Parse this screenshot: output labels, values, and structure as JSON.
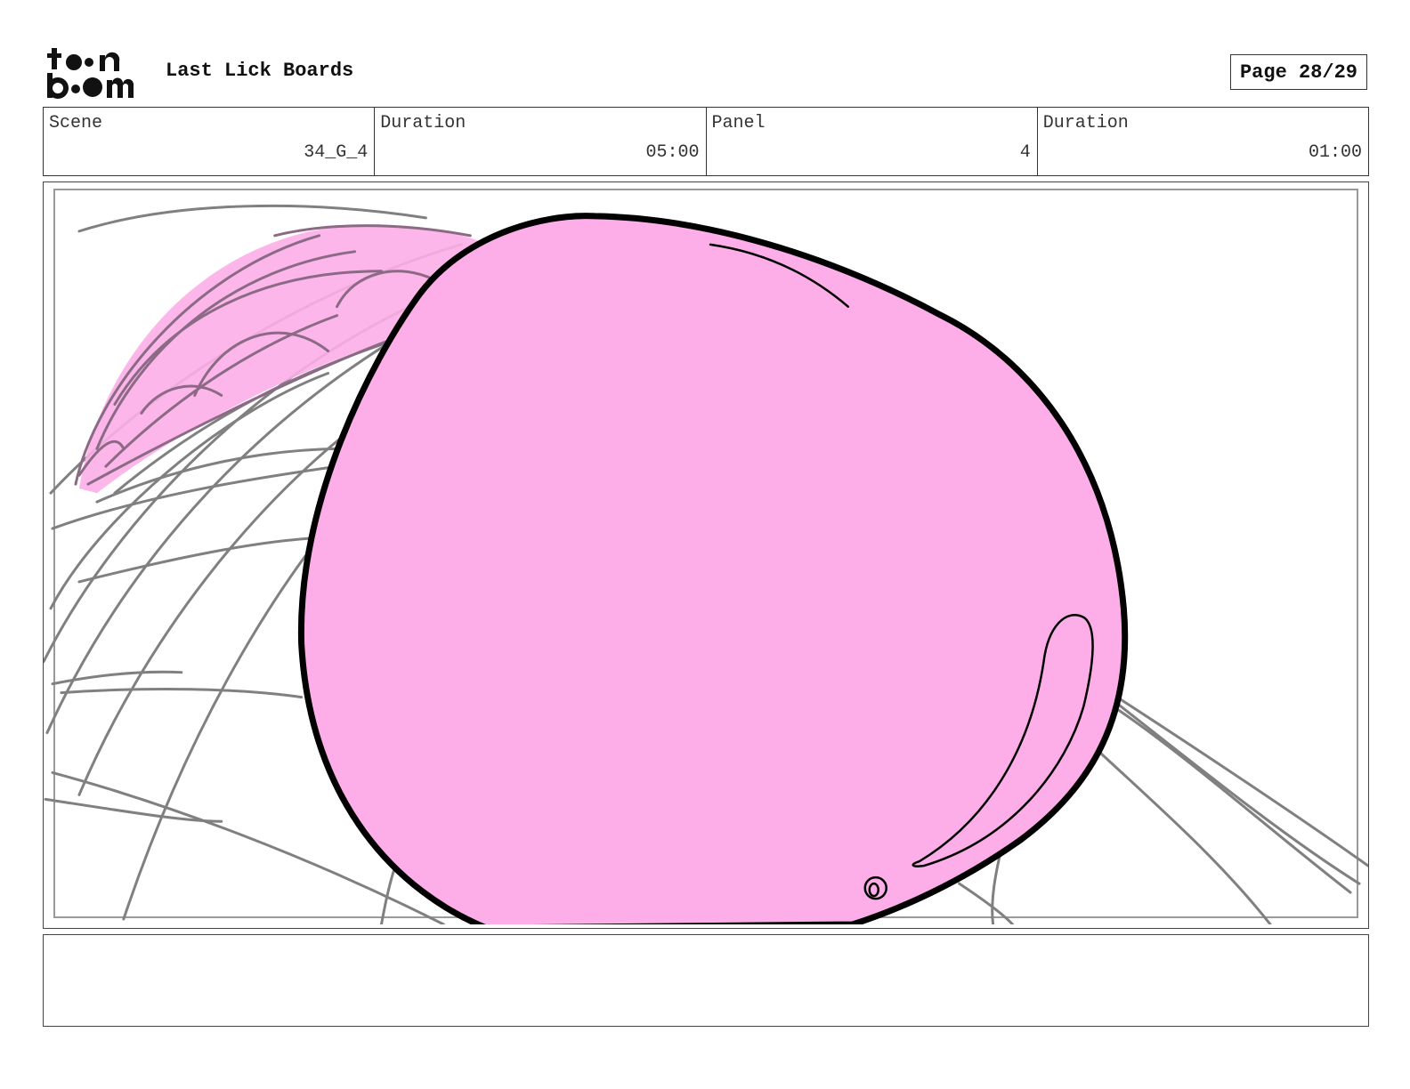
{
  "header": {
    "logo_icon": "toonboom-logo-icon",
    "title": "Last Lick Boards",
    "page_label": "Page 28/29"
  },
  "info": [
    {
      "label": "Scene",
      "value": "34_G_4"
    },
    {
      "label": "Duration",
      "value": "05:00"
    },
    {
      "label": "Panel",
      "value": "4"
    },
    {
      "label": "Duration",
      "value": "01:00"
    }
  ],
  "panel": {
    "fill_color": "#fdaee8",
    "outline_color": "#000000",
    "sketch_color": "#808080"
  },
  "notes": {
    "text": ""
  }
}
